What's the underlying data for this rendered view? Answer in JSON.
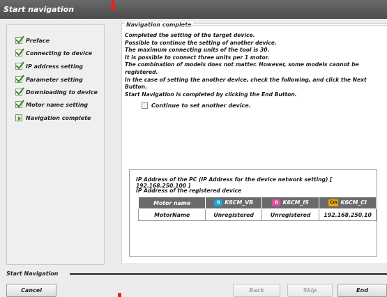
{
  "window": {
    "title": "Start navigation"
  },
  "sidebar": {
    "steps": [
      {
        "label": "Preface",
        "state": "done"
      },
      {
        "label": "Connecting to device",
        "state": "done"
      },
      {
        "label": "IP address setting",
        "state": "done"
      },
      {
        "label": "Parameter setting",
        "state": "done"
      },
      {
        "label": "Downloading to device",
        "state": "done"
      },
      {
        "label": "Motor name setting",
        "state": "done"
      },
      {
        "label": "Navigation complete",
        "state": "current"
      }
    ]
  },
  "main": {
    "group_title": "Navigation complete",
    "description": [
      "Completed the setting of the target device.",
      "Possible to continue the setting of another device.",
      "The maximum connecting units of the tool is 30.",
      "It is possible to connect three units per 1 motor.",
      "The combination of models does not matter. However, some models cannot be registered.",
      "In the case of setting the another device, check the following, and click the Next Button.",
      "Start Navigation is completed by clicking the End Button."
    ],
    "continue_label": "Continue to set another device.",
    "continue_checked": false,
    "ip_pc_text": "IP Address of the PC (IP Address for the device network setting)  [ 192.168.250.100 ]",
    "ip_registered_label": "IP Address of the registered device",
    "table": {
      "headers": [
        "Motor name",
        "K6CM_VB",
        "K6CM_IS",
        "K6CM_CI"
      ],
      "header_icons": [
        "",
        "vb-icon",
        "is-icon",
        "ci-icon"
      ],
      "rows": [
        [
          "MotorName",
          "Unregistered",
          "Unregistered",
          "192.168.250.10"
        ]
      ]
    }
  },
  "footer": {
    "section_label": "Start Navigation",
    "cancel_label": "Cancel",
    "back_label": "Back",
    "skip_label": "Skip",
    "end_label": "End"
  },
  "colors": {
    "titlebar": "#555555",
    "check_green": "#3f8a2a",
    "table_header": "#6b6b6b",
    "annotation_red": "#e0261f"
  }
}
